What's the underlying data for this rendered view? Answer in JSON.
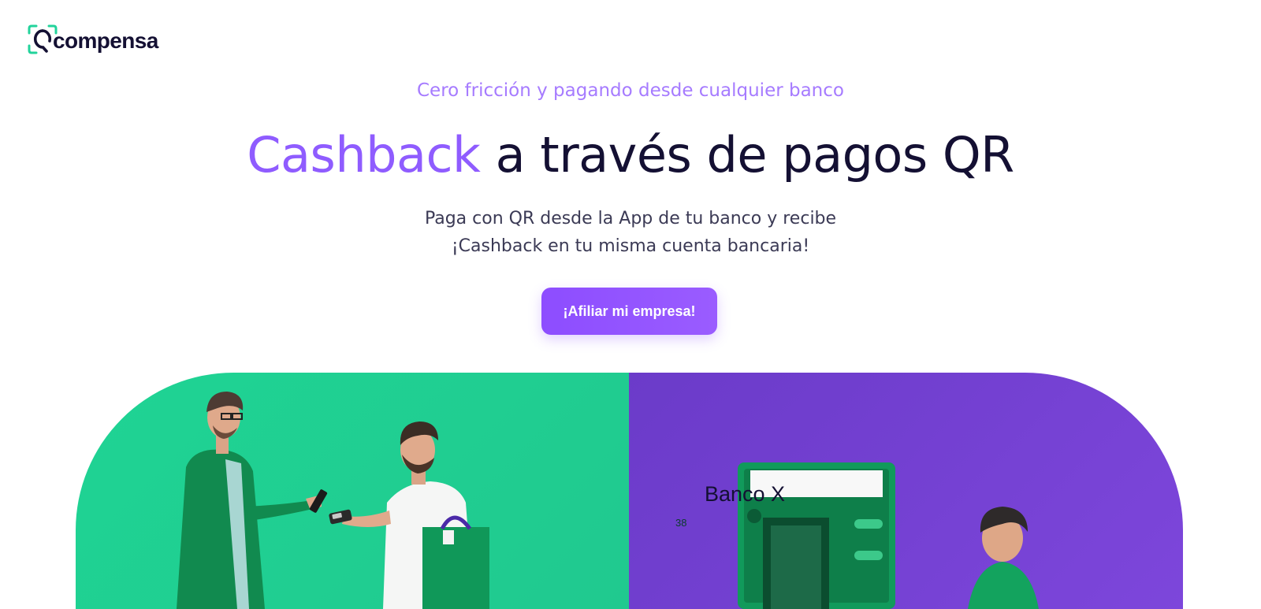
{
  "brand": {
    "logo_text": "compensa",
    "logo_icon": "qr-scan-icon"
  },
  "hero": {
    "eyebrow": "Cero fricción y pagando desde cualquier banco",
    "headline_accent": "Cashback",
    "headline_rest": " a través de pagos QR",
    "subtitle_line1": "Paga con QR desde la App de tu banco y recibe",
    "subtitle_line2": "¡Cashback en tu misma cuenta bancaria!",
    "cta_label": "¡Afiliar mi empresa!"
  },
  "illustration": {
    "atm_title": "Banco X",
    "atm_number": "38"
  },
  "colors": {
    "accent_purple": "#8f5cff",
    "brand_green": "#1fd494",
    "panel_purple": "#6b3bc9",
    "text_dark": "#141033"
  }
}
